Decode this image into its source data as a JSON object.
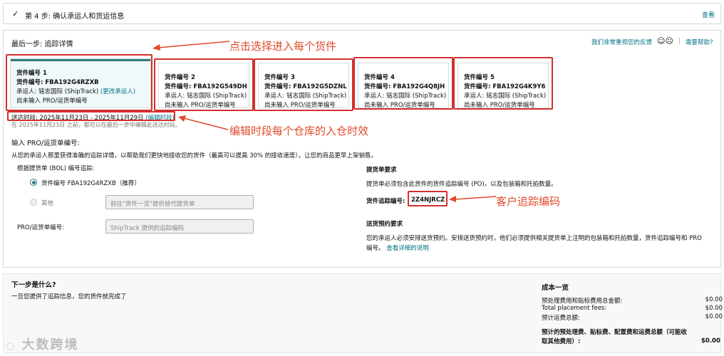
{
  "step": {
    "check_icon": "checkmark-icon",
    "title": "第 4 步:  确认承运人和货运信息",
    "view_label": "查看"
  },
  "section": {
    "subtitle": "最后一步: 追踪详情",
    "feedback_label": "我们非常重视您的反馈",
    "help_label": "需要帮助?"
  },
  "shipments": [
    {
      "label": "货件编号 1",
      "id_line": "货件编号: FBA192G4RZXB",
      "carrier": "承运人: 铭志国际 (ShipTrack)",
      "change_carrier": "(更改承运人)",
      "pro_status": "尚未输入 PRO/运货单编号"
    },
    {
      "label": "货件编号 2",
      "id_line": "货件编号: FBA192G549DH",
      "carrier": "承运人: 铭志国际 (ShipTrack)",
      "pro_status": "尚未输入 PRO/运货单编号"
    },
    {
      "label": "货件编号 3",
      "id_line": "货件编号: FBA192G5DZNL",
      "carrier": "承运人: 铭志国际 (ShipTrack)",
      "pro_status": "尚未输入 PRO/运货单编号"
    },
    {
      "label": "货件编号 4",
      "id_line": "货件编号: FBA192G4Q8JH",
      "carrier": "承运人: 铭志国际 (ShipTrack)",
      "pro_status": "尚未输入 PRO/运货单编号"
    },
    {
      "label": "货件编号 5",
      "id_line": "货件编号: FBA192G4K9Y6",
      "carrier": "承运人: 铭志国际 (ShipTrack)",
      "pro_status": "尚未输入 PRO/运货单编号"
    }
  ],
  "delivery": {
    "window_label": "送达时段: 2025年11月23日 - 2025年11月29日",
    "edit_link": "(编辑时段)",
    "note": "在 2025年11月23日 之前，都可以在最后一步中编辑此送达时段。"
  },
  "tracking": {
    "heading": "输入 PRO/运货单编号:",
    "description": "从您的承运人那里获得准确的追踪详情，以帮助我们更快地接收您的货件（最高可以提高 30% 的接收速度），让您的商品更早上架销售。",
    "bol_label": "根据提货单 (BOL) 编号追踪:",
    "option_recommended": "货件编号 FBA192G4RZXB（推荐）",
    "option_other": "其他",
    "other_placeholder": "前往\"货件一览\"提供替代提货单",
    "pro_label": "PRO/运货单编号:",
    "pro_placeholder": "ShipTrack 提供的追踪编码"
  },
  "bol_requirements": {
    "heading": "提货单要求",
    "text": "提货单必须包含此货件的货件追踪编号 (PO)，以及包装箱和托拍数量。",
    "po_label": "货件追踪编号:",
    "po_value": "2Z4NJRCZ"
  },
  "appointment": {
    "heading": "送货预约要求",
    "text": "您的承运人必须安排送货预约。安排送货预约时，他们必须提供相关提货单上注明的包装箱和托拍数量，货件追踪编号和 PRO 编号。",
    "link": "查看详细的说明"
  },
  "next": {
    "heading": "下一步是什么?",
    "text": "一旦您提供了追踪信息，您的货件就完成了"
  },
  "costs": {
    "heading": "成本一览",
    "rows": [
      {
        "label": "预处理费用和贴标费用总金额:",
        "value": "$0.00"
      },
      {
        "label": "Total placement fees:",
        "value": "$0.00"
      },
      {
        "label": "预计运费总额:",
        "value": "$0.00"
      }
    ],
    "total_label": "预计的预处理费、贴标费、配置费和运费总额（可能收取其他费用）:",
    "total_value": "$0.00"
  },
  "annotations": {
    "select_shipment": "点击选择进入每个货件",
    "edit_window": "编辑时段每个仓库的入仓时效",
    "tracking_code": "客户追踪编码"
  },
  "watermark": "大数跨境",
  "colors": {
    "accent": "#2c7b7e",
    "link": "#007185",
    "annotation": "#e04b2a",
    "redbox": "#d32f2f"
  }
}
